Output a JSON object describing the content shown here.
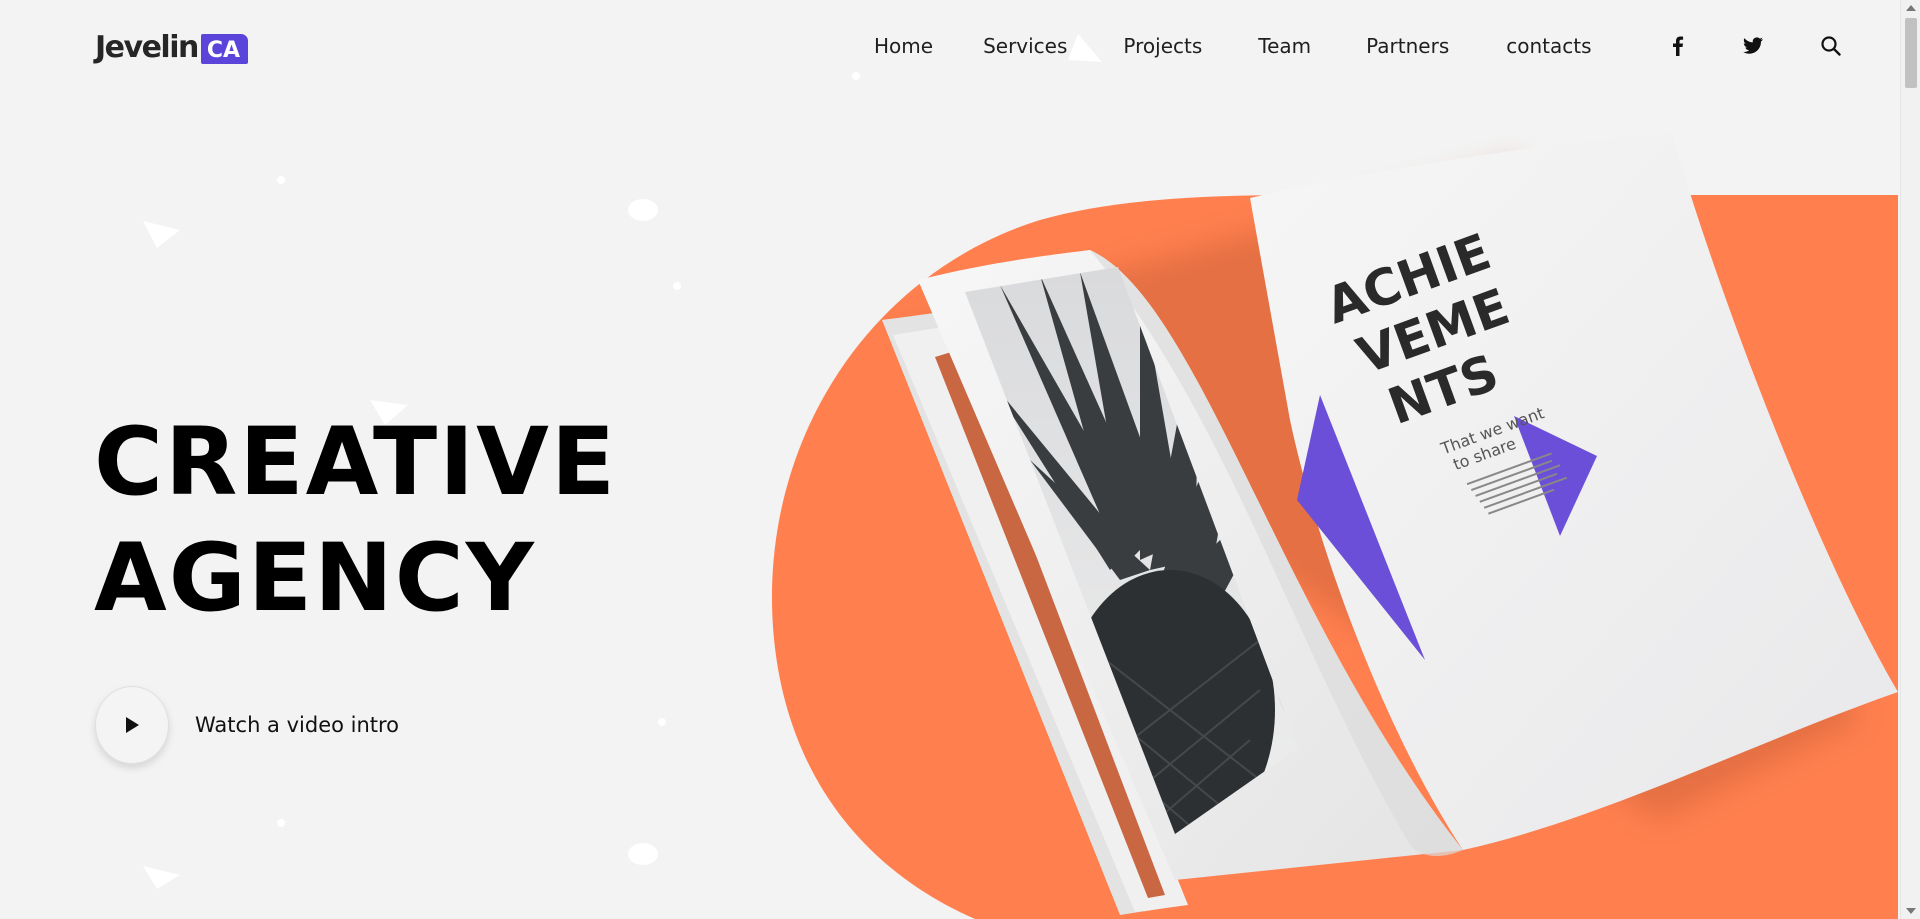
{
  "brand": {
    "name": "Jevelin",
    "badge": "CA",
    "accent": "#5b44d9"
  },
  "nav": {
    "links": [
      "Home",
      "Services",
      "Projects",
      "Team",
      "Partners",
      "contacts"
    ],
    "icons": [
      "facebook-icon",
      "twitter-icon",
      "search-icon"
    ]
  },
  "hero": {
    "title_line1": "CREATIVE",
    "title_line2": "AGENCY",
    "video_label": "Watch a video intro"
  },
  "magazine": {
    "heading_line1": "ACHIE",
    "heading_line2": "VEME",
    "heading_line3": "NTS",
    "subheading_line1": "That we want",
    "subheading_line2": "to share"
  },
  "colors": {
    "orange": "#ff7f4f",
    "purple": "#6b4fd8",
    "background": "#f3f3f3"
  }
}
